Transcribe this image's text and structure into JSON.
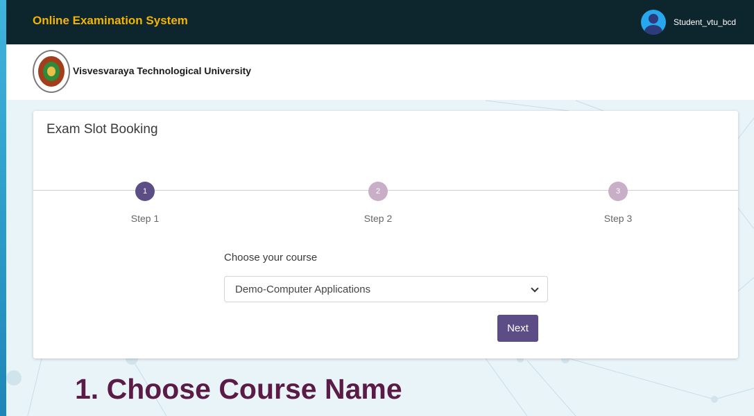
{
  "header": {
    "app_title": "Online Examination System",
    "username": "Student_vtu_bcd",
    "avatar_icon": "user-avatar-icon"
  },
  "brand": {
    "university_name": "Visvesvaraya Technological University",
    "logo_icon": "university-seal-logo"
  },
  "booking": {
    "title": "Exam Slot Booking",
    "steps": [
      {
        "number": "1",
        "label": "Step 1",
        "state": "active"
      },
      {
        "number": "2",
        "label": "Step 2",
        "state": "pending"
      },
      {
        "number": "3",
        "label": "Step 3",
        "state": "pending"
      }
    ],
    "course_label": "Choose your course",
    "course_selected": "Demo-Computer Applications",
    "next_label": "Next"
  },
  "caption": "1. Choose Course Name",
  "colors": {
    "topbar": "#0d262e",
    "title_accent": "#f4b400",
    "primary": "#5d4d86",
    "step_pending": "#c9aec7",
    "caption": "#5a1b47"
  }
}
